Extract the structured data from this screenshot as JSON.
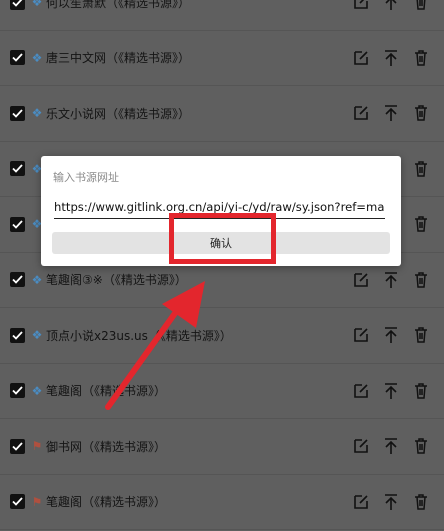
{
  "rows": [
    {
      "name": "何以笙箫默（《精选书源》）",
      "icon": "diamond"
    },
    {
      "name": "唐三中文网（《精选书源》）",
      "icon": "diamond"
    },
    {
      "name": "乐文小说网（《精选书源》）",
      "icon": "diamond"
    },
    {
      "name": "",
      "icon": "diamond"
    },
    {
      "name": "",
      "icon": "diamond"
    },
    {
      "name": "笔趣阁③※（《精选书源》）",
      "icon": "diamond"
    },
    {
      "name": "顶点小说x23us.us（《精选书源》）",
      "icon": "diamond"
    },
    {
      "name": "笔趣阁（《精选书源》）",
      "icon": "diamond"
    },
    {
      "name": "御书网（《精选书源》）",
      "icon": "flag"
    },
    {
      "name": "笔趣阁（《精选书源》）",
      "icon": "flag"
    }
  ],
  "dialog": {
    "title": "输入书源网址",
    "url_value": "https://www.gitlink.org.cn/api/yi-c/yd/raw/sy.json?ref=master",
    "confirm_label": "确认"
  },
  "colors": {
    "highlight": "#e3262d",
    "arrow": "#e3262d",
    "overlay_bg": "#5f5f5f"
  },
  "icons": [
    "checkbox-checked-icon",
    "diamond-icon",
    "flag-icon",
    "edit-icon",
    "move-top-icon",
    "trash-icon",
    "arrow-annotation"
  ]
}
